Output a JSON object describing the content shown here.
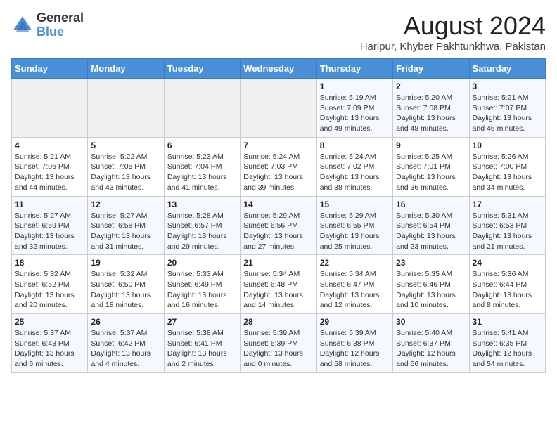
{
  "logo": {
    "general": "General",
    "blue": "Blue"
  },
  "title": "August 2024",
  "subtitle": "Haripur, Khyber Pakhtunkhwa, Pakistan",
  "days_of_week": [
    "Sunday",
    "Monday",
    "Tuesday",
    "Wednesday",
    "Thursday",
    "Friday",
    "Saturday"
  ],
  "weeks": [
    [
      {
        "day": "",
        "info": ""
      },
      {
        "day": "",
        "info": ""
      },
      {
        "day": "",
        "info": ""
      },
      {
        "day": "",
        "info": ""
      },
      {
        "day": "1",
        "info": "Sunrise: 5:19 AM\nSunset: 7:09 PM\nDaylight: 13 hours\nand 49 minutes."
      },
      {
        "day": "2",
        "info": "Sunrise: 5:20 AM\nSunset: 7:08 PM\nDaylight: 13 hours\nand 48 minutes."
      },
      {
        "day": "3",
        "info": "Sunrise: 5:21 AM\nSunset: 7:07 PM\nDaylight: 13 hours\nand 46 minutes."
      }
    ],
    [
      {
        "day": "4",
        "info": "Sunrise: 5:21 AM\nSunset: 7:06 PM\nDaylight: 13 hours\nand 44 minutes."
      },
      {
        "day": "5",
        "info": "Sunrise: 5:22 AM\nSunset: 7:05 PM\nDaylight: 13 hours\nand 43 minutes."
      },
      {
        "day": "6",
        "info": "Sunrise: 5:23 AM\nSunset: 7:04 PM\nDaylight: 13 hours\nand 41 minutes."
      },
      {
        "day": "7",
        "info": "Sunrise: 5:24 AM\nSunset: 7:03 PM\nDaylight: 13 hours\nand 39 minutes."
      },
      {
        "day": "8",
        "info": "Sunrise: 5:24 AM\nSunset: 7:02 PM\nDaylight: 13 hours\nand 38 minutes."
      },
      {
        "day": "9",
        "info": "Sunrise: 5:25 AM\nSunset: 7:01 PM\nDaylight: 13 hours\nand 36 minutes."
      },
      {
        "day": "10",
        "info": "Sunrise: 5:26 AM\nSunset: 7:00 PM\nDaylight: 13 hours\nand 34 minutes."
      }
    ],
    [
      {
        "day": "11",
        "info": "Sunrise: 5:27 AM\nSunset: 6:59 PM\nDaylight: 13 hours\nand 32 minutes."
      },
      {
        "day": "12",
        "info": "Sunrise: 5:27 AM\nSunset: 6:58 PM\nDaylight: 13 hours\nand 31 minutes."
      },
      {
        "day": "13",
        "info": "Sunrise: 5:28 AM\nSunset: 6:57 PM\nDaylight: 13 hours\nand 29 minutes."
      },
      {
        "day": "14",
        "info": "Sunrise: 5:29 AM\nSunset: 6:56 PM\nDaylight: 13 hours\nand 27 minutes."
      },
      {
        "day": "15",
        "info": "Sunrise: 5:29 AM\nSunset: 6:55 PM\nDaylight: 13 hours\nand 25 minutes."
      },
      {
        "day": "16",
        "info": "Sunrise: 5:30 AM\nSunset: 6:54 PM\nDaylight: 13 hours\nand 23 minutes."
      },
      {
        "day": "17",
        "info": "Sunrise: 5:31 AM\nSunset: 6:53 PM\nDaylight: 13 hours\nand 21 minutes."
      }
    ],
    [
      {
        "day": "18",
        "info": "Sunrise: 5:32 AM\nSunset: 6:52 PM\nDaylight: 13 hours\nand 20 minutes."
      },
      {
        "day": "19",
        "info": "Sunrise: 5:32 AM\nSunset: 6:50 PM\nDaylight: 13 hours\nand 18 minutes."
      },
      {
        "day": "20",
        "info": "Sunrise: 5:33 AM\nSunset: 6:49 PM\nDaylight: 13 hours\nand 16 minutes."
      },
      {
        "day": "21",
        "info": "Sunrise: 5:34 AM\nSunset: 6:48 PM\nDaylight: 13 hours\nand 14 minutes."
      },
      {
        "day": "22",
        "info": "Sunrise: 5:34 AM\nSunset: 6:47 PM\nDaylight: 13 hours\nand 12 minutes."
      },
      {
        "day": "23",
        "info": "Sunrise: 5:35 AM\nSunset: 6:46 PM\nDaylight: 13 hours\nand 10 minutes."
      },
      {
        "day": "24",
        "info": "Sunrise: 5:36 AM\nSunset: 6:44 PM\nDaylight: 13 hours\nand 8 minutes."
      }
    ],
    [
      {
        "day": "25",
        "info": "Sunrise: 5:37 AM\nSunset: 6:43 PM\nDaylight: 13 hours\nand 6 minutes."
      },
      {
        "day": "26",
        "info": "Sunrise: 5:37 AM\nSunset: 6:42 PM\nDaylight: 13 hours\nand 4 minutes."
      },
      {
        "day": "27",
        "info": "Sunrise: 5:38 AM\nSunset: 6:41 PM\nDaylight: 13 hours\nand 2 minutes."
      },
      {
        "day": "28",
        "info": "Sunrise: 5:39 AM\nSunset: 6:39 PM\nDaylight: 13 hours\nand 0 minutes."
      },
      {
        "day": "29",
        "info": "Sunrise: 5:39 AM\nSunset: 6:38 PM\nDaylight: 12 hours\nand 58 minutes."
      },
      {
        "day": "30",
        "info": "Sunrise: 5:40 AM\nSunset: 6:37 PM\nDaylight: 12 hours\nand 56 minutes."
      },
      {
        "day": "31",
        "info": "Sunrise: 5:41 AM\nSunset: 6:35 PM\nDaylight: 12 hours\nand 54 minutes."
      }
    ]
  ]
}
